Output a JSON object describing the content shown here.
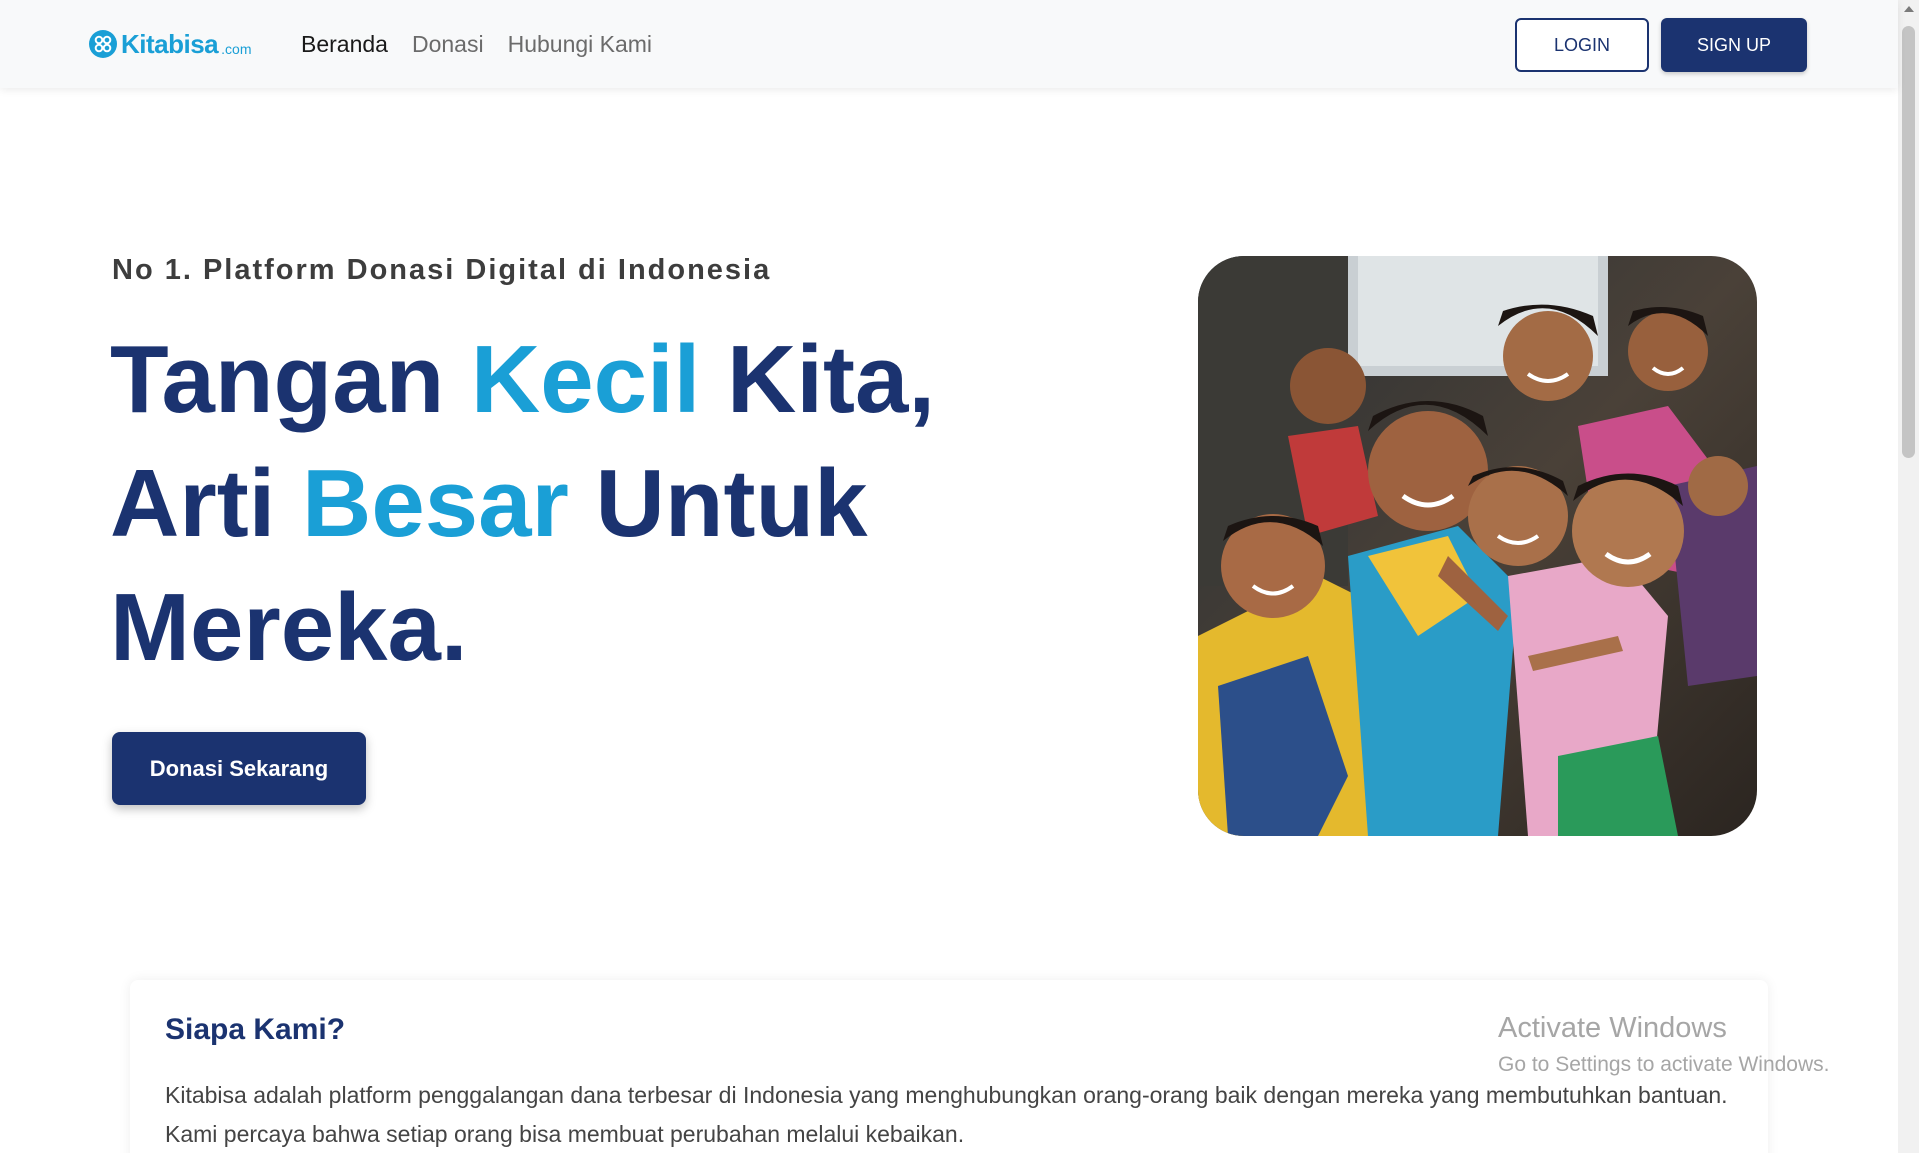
{
  "brand": {
    "name": "Kitabisa",
    "suffix": ".com",
    "color": "#1a9fd6"
  },
  "nav": {
    "links": [
      {
        "label": "Beranda",
        "active": true
      },
      {
        "label": "Donasi",
        "active": false
      },
      {
        "label": "Hubungi Kami",
        "active": false
      }
    ],
    "login_label": "LOGIN",
    "signup_label": "SIGN UP"
  },
  "hero": {
    "tagline": "No 1. Platform Donasi Digital di Indonesia",
    "headline": {
      "line1_a": "Tangan ",
      "line1_accent": "Kecil",
      "line1_b": " Kita,",
      "line2_a": "Arti ",
      "line2_accent": "Besar",
      "line2_b": " Untuk",
      "line3": "Mereka."
    },
    "cta_label": "Donasi Sekarang",
    "image_icon": "children-photo"
  },
  "about": {
    "title": "Siapa Kami?",
    "text": "Kitabisa adalah platform penggalangan dana terbesar di Indonesia yang menghubungkan orang-orang baik dengan mereka yang membutuhkan bantuan. Kami percaya bahwa setiap orang bisa membuat perubahan melalui kebaikan."
  },
  "watermark": {
    "title": "Activate Windows",
    "subtitle": "Go to Settings to activate Windows."
  },
  "colors": {
    "primary": "#1b3370",
    "accent": "#1a9fd6",
    "navbar_bg": "#f8f9fa"
  }
}
